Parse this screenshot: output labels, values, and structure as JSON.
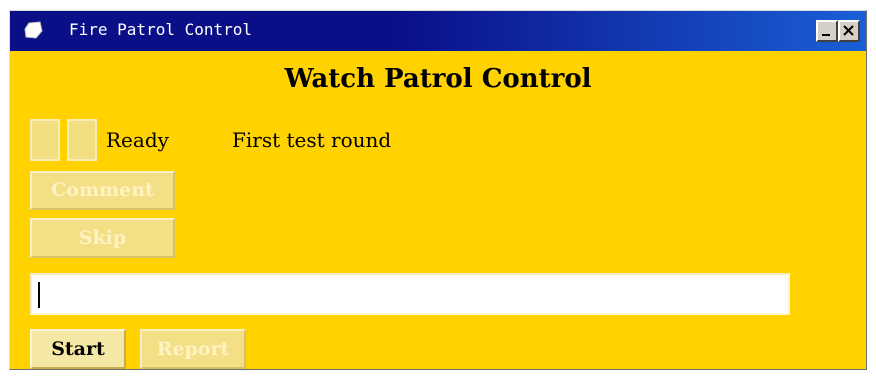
{
  "window": {
    "title": "Fire Patrol Control",
    "icon": "app-icon",
    "controls": {
      "minimize_label": "_",
      "close_label": "✕"
    }
  },
  "main": {
    "heading": "Watch Patrol Control",
    "status": "Ready",
    "round": "First test round",
    "buttons": {
      "comment": "Comment",
      "skip": "Skip",
      "start": "Start",
      "report": "Report"
    },
    "input": {
      "value": ""
    }
  },
  "colors": {
    "background": "#ffd200",
    "titlebar": "#0a0f88",
    "disabled_text": "#fff3c2"
  }
}
